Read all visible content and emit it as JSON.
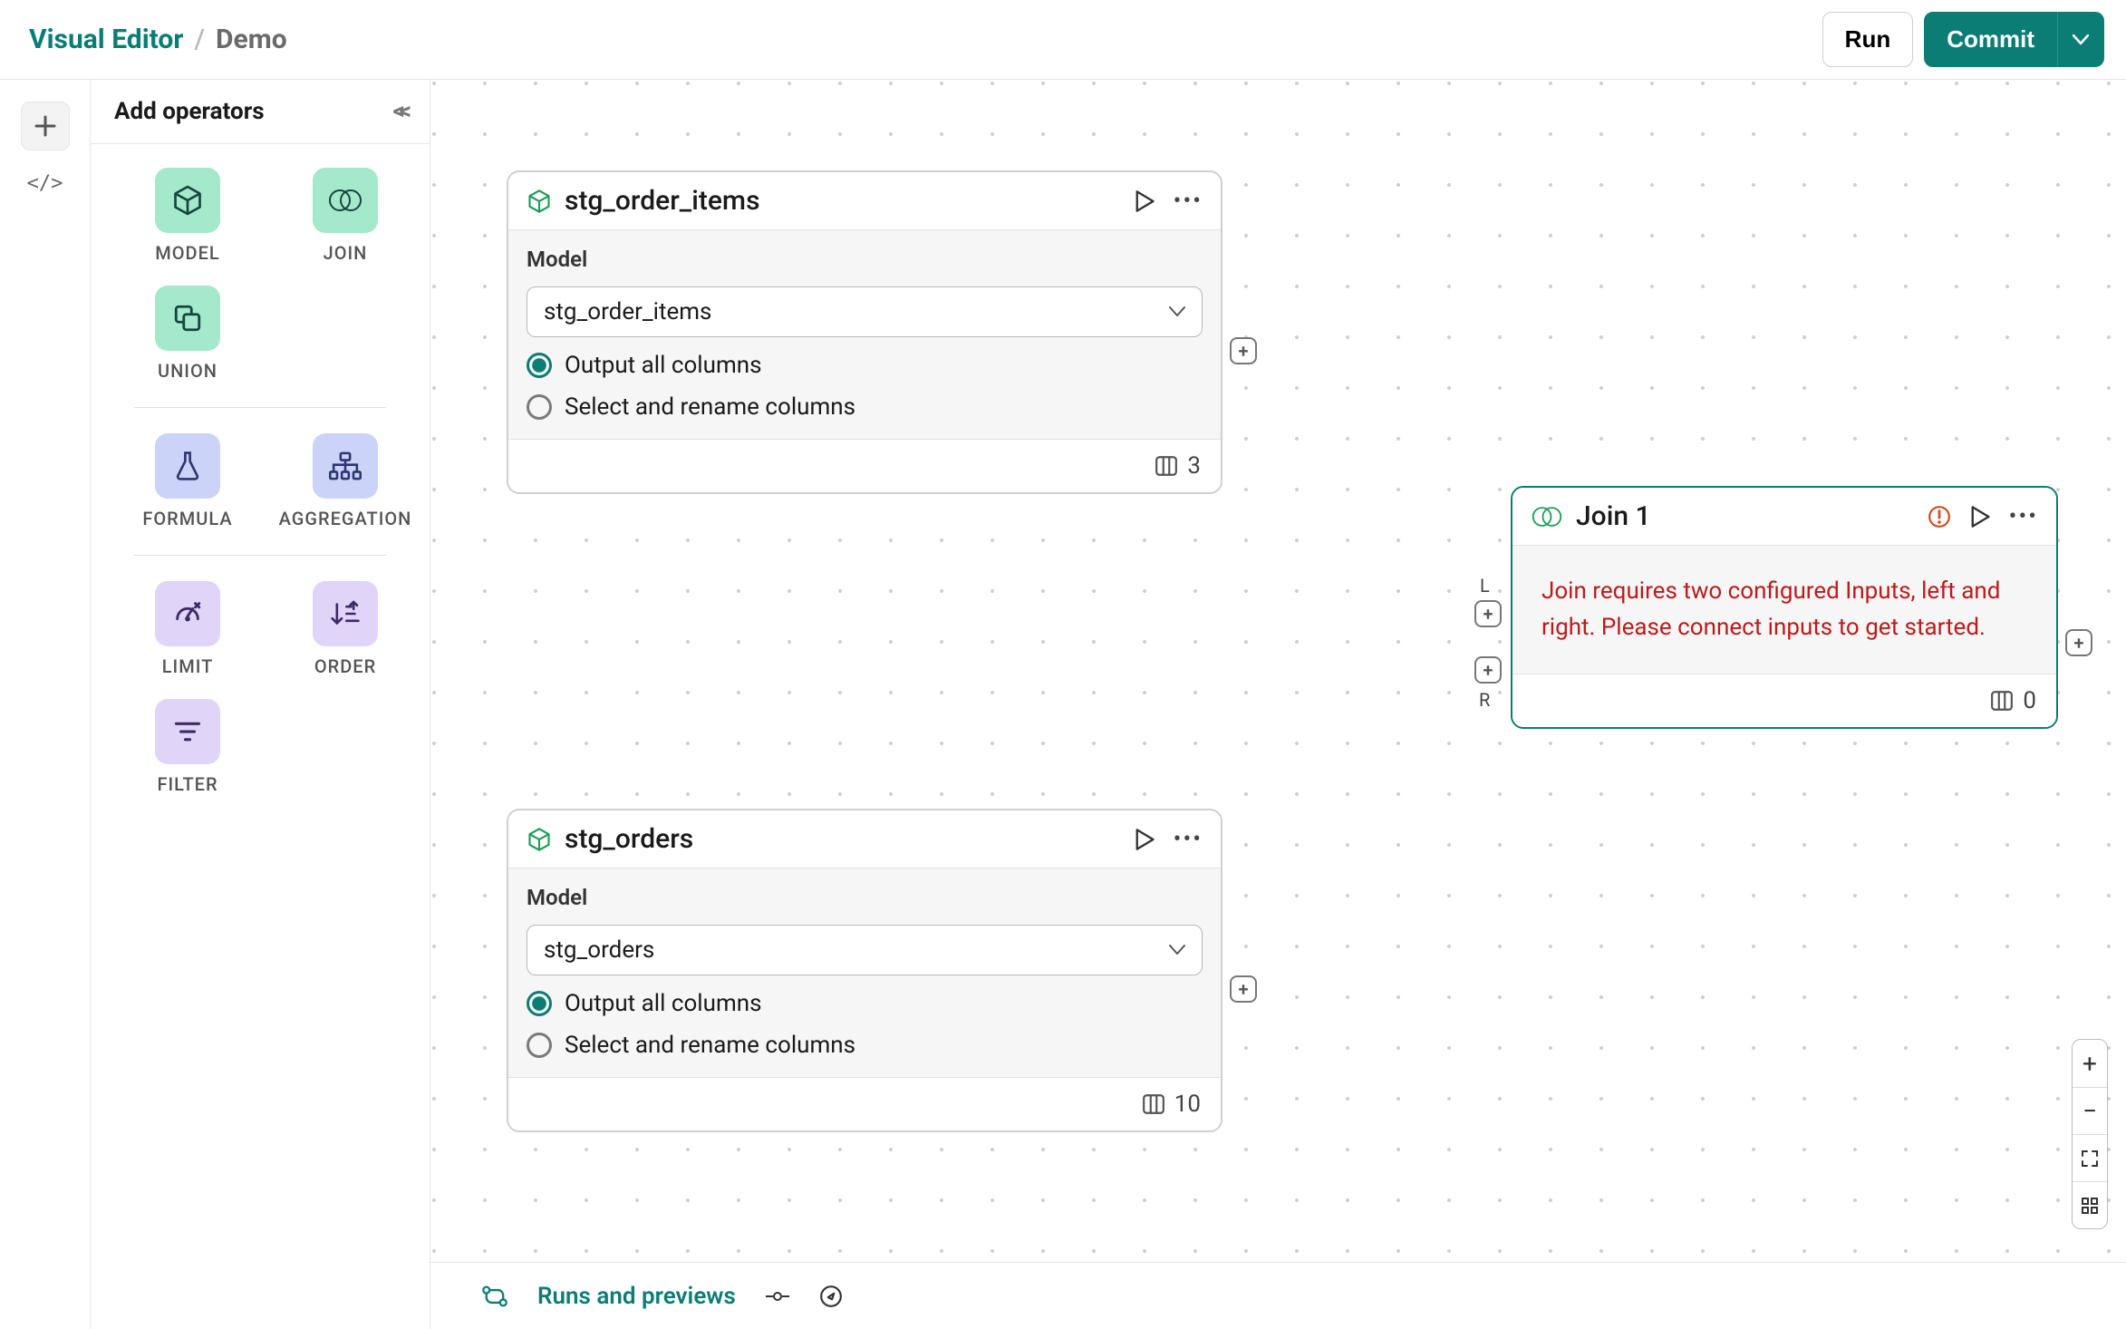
{
  "header": {
    "root_label": "Visual Editor",
    "current_label": "Demo",
    "run_label": "Run",
    "commit_label": "Commit"
  },
  "sidebar": {
    "title": "Add operators",
    "operators": {
      "model": "MODEL",
      "join": "JOIN",
      "union": "UNION",
      "formula": "FORMULA",
      "aggregation": "AGGREGATION",
      "limit": "LIMIT",
      "order": "ORDER",
      "filter": "FILTER"
    }
  },
  "nodes": {
    "node1": {
      "title": "stg_order_items",
      "section_label": "Model",
      "select_value": "stg_order_items",
      "opt_all": "Output all columns",
      "opt_select": "Select and rename columns",
      "col_count": "3"
    },
    "node2": {
      "title": "stg_orders",
      "section_label": "Model",
      "select_value": "stg_orders",
      "opt_all": "Output all columns",
      "opt_select": "Select and rename columns",
      "col_count": "10"
    },
    "join1": {
      "title": "Join 1",
      "error_text": "Join requires two configured Inputs, left and right. Please connect inputs to get started.",
      "col_count": "0",
      "left_label": "L",
      "right_label": "R"
    }
  },
  "bottom": {
    "label": "Runs and previews"
  }
}
